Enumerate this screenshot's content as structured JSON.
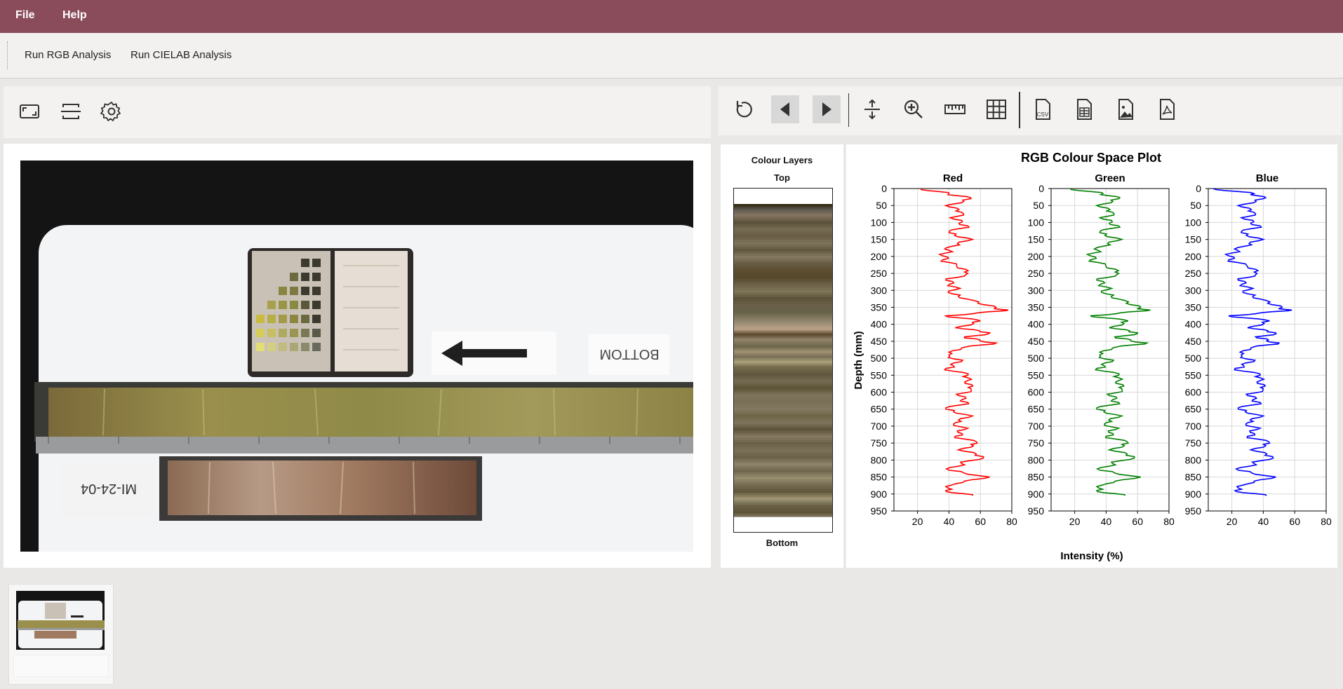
{
  "menu": {
    "file": "File",
    "help": "Help"
  },
  "actions": {
    "rgb": "Run RGB Analysis",
    "cielab": "Run CIELAB Analysis"
  },
  "left_tools": [
    "fit-window-icon",
    "crop-icon",
    "gear-icon"
  ],
  "right_tools": [
    "reset-icon",
    "prev-icon",
    "next-icon",
    "fit-vertical-icon",
    "zoom-icon",
    "ruler-icon",
    "grid-icon",
    "export-csv-icon",
    "export-spreadsheet-icon",
    "export-image-icon",
    "export-pdf-icon"
  ],
  "photo": {
    "tag": "MI-24-04",
    "card": "BOTTOM"
  },
  "layers": {
    "title": "Colour Layers",
    "top": "Top",
    "bottom": "Bottom"
  },
  "chart_data": {
    "type": "line",
    "title": "RGB Colour Space Plot",
    "xlabel": "Intensity (%)",
    "ylabel": "Depth (mm)",
    "ylim": [
      950,
      0
    ],
    "yticks": [
      0,
      50,
      100,
      150,
      200,
      250,
      300,
      350,
      400,
      450,
      500,
      550,
      600,
      650,
      700,
      750,
      800,
      850,
      900,
      950
    ],
    "panels": [
      {
        "name": "Red",
        "color": "#ff0000",
        "xlim": [
          5,
          80
        ],
        "xticks": [
          20,
          40,
          60,
          80
        ],
        "depth": [
          0,
          15,
          30,
          50,
          70,
          90,
          110,
          130,
          150,
          170,
          190,
          210,
          230,
          250,
          270,
          290,
          310,
          330,
          350,
          360,
          375,
          390,
          410,
          425,
          440,
          455,
          470,
          490,
          510,
          530,
          550,
          570,
          590,
          610,
          630,
          650,
          670,
          690,
          710,
          730,
          750,
          770,
          790,
          810,
          830,
          850,
          870,
          890,
          905
        ],
        "values": [
          22,
          40,
          54,
          38,
          48,
          43,
          52,
          40,
          55,
          42,
          38,
          36,
          45,
          52,
          38,
          44,
          42,
          56,
          70,
          76,
          38,
          60,
          44,
          66,
          50,
          70,
          48,
          40,
          48,
          38,
          52,
          50,
          54,
          46,
          52,
          38,
          55,
          44,
          50,
          44,
          58,
          46,
          62,
          48,
          40,
          66,
          44,
          38,
          55
        ]
      },
      {
        "name": "Green",
        "color": "#008000",
        "xlim": [
          5,
          80
        ],
        "xticks": [
          20,
          40,
          60,
          80
        ],
        "depth": [
          0,
          15,
          30,
          50,
          70,
          90,
          110,
          130,
          150,
          170,
          190,
          210,
          230,
          250,
          270,
          290,
          310,
          330,
          350,
          360,
          375,
          390,
          410,
          425,
          440,
          455,
          470,
          490,
          510,
          530,
          550,
          570,
          590,
          610,
          630,
          650,
          670,
          690,
          710,
          730,
          750,
          770,
          790,
          810,
          830,
          850,
          870,
          890,
          905
        ],
        "values": [
          17,
          38,
          48,
          34,
          44,
          38,
          48,
          36,
          50,
          38,
          32,
          30,
          40,
          48,
          34,
          40,
          40,
          52,
          62,
          66,
          30,
          54,
          42,
          60,
          46,
          66,
          44,
          36,
          44,
          34,
          48,
          46,
          50,
          42,
          48,
          34,
          50,
          40,
          46,
          40,
          54,
          42,
          58,
          44,
          36,
          62,
          40,
          34,
          52
        ]
      },
      {
        "name": "Blue",
        "color": "#0000ff",
        "xlim": [
          5,
          80
        ],
        "xticks": [
          20,
          40,
          60,
          80
        ],
        "depth": [
          0,
          15,
          30,
          50,
          70,
          90,
          110,
          130,
          150,
          170,
          190,
          210,
          230,
          250,
          270,
          290,
          310,
          330,
          350,
          360,
          375,
          390,
          410,
          425,
          440,
          455,
          470,
          490,
          510,
          530,
          550,
          570,
          590,
          610,
          630,
          650,
          670,
          690,
          710,
          730,
          750,
          770,
          790,
          810,
          830,
          850,
          870,
          890,
          905
        ],
        "values": [
          8,
          34,
          40,
          24,
          34,
          28,
          38,
          26,
          40,
          28,
          20,
          18,
          30,
          36,
          24,
          30,
          30,
          42,
          52,
          56,
          18,
          44,
          30,
          48,
          36,
          50,
          32,
          26,
          34,
          22,
          38,
          36,
          40,
          30,
          38,
          24,
          40,
          30,
          36,
          30,
          44,
          32,
          46,
          34,
          24,
          48,
          30,
          22,
          42
        ]
      }
    ]
  }
}
